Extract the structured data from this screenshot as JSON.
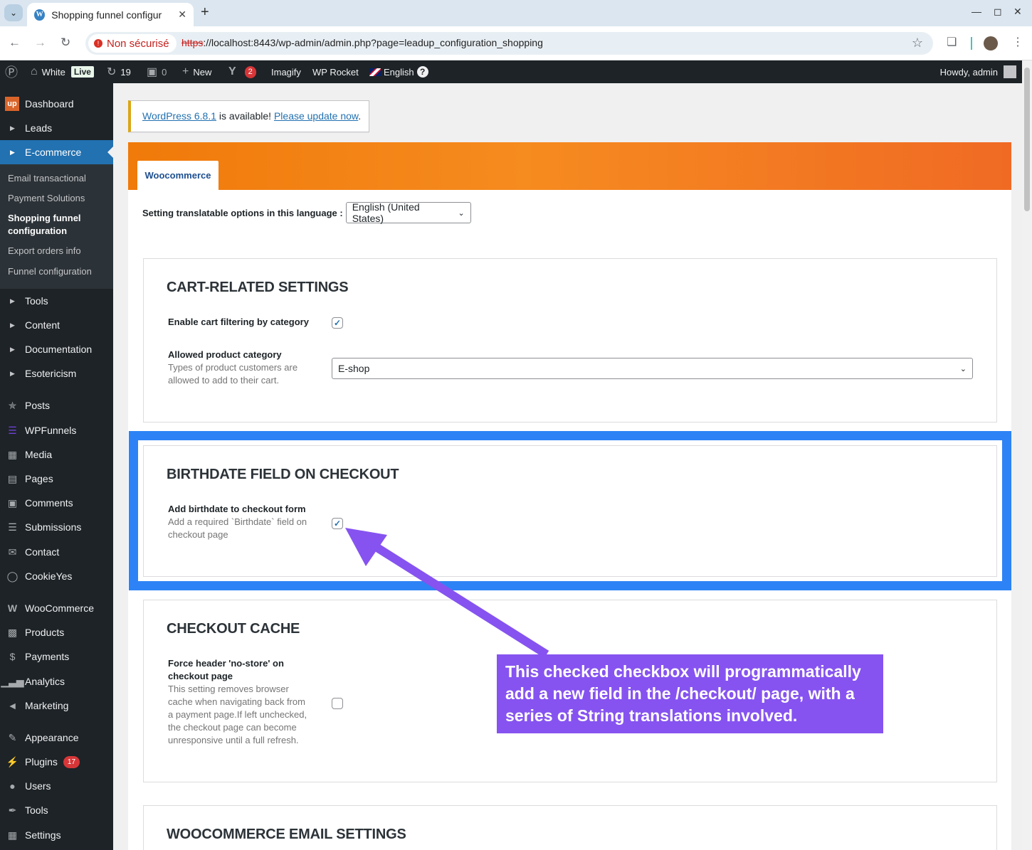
{
  "browser": {
    "tab_title": "Shopping funnel configur",
    "security_label": "Non sécurisé",
    "url_scheme": "https",
    "url_rest": "://localhost:8443/wp-admin/admin.php?page=leadup_configuration_shopping"
  },
  "adminbar": {
    "site_name": "White",
    "live_badge": "Live",
    "updates_count": "19",
    "comments_count": "0",
    "new_label": "New",
    "yoast_count": "2",
    "imagify": "Imagify",
    "wp_rocket": "WP Rocket",
    "language": "English",
    "howdy": "Howdy, admin"
  },
  "sidebar": {
    "items": [
      {
        "label": "Dashboard",
        "icon": "up-logo"
      },
      {
        "label": "Leads",
        "icon": "arrow-right-icon"
      },
      {
        "label": "E-commerce",
        "icon": "arrow-right-icon"
      },
      {
        "label": "Tools",
        "icon": "arrow-right-icon"
      },
      {
        "label": "Content",
        "icon": "arrow-right-icon"
      },
      {
        "label": "Documentation",
        "icon": "arrow-right-icon"
      },
      {
        "label": "Esotericism",
        "icon": "arrow-right-icon"
      },
      {
        "label": "Posts",
        "icon": "pin-icon"
      },
      {
        "label": "WPFunnels",
        "icon": "funnel-icon"
      },
      {
        "label": "Media",
        "icon": "media-icon"
      },
      {
        "label": "Pages",
        "icon": "pages-icon"
      },
      {
        "label": "Comments",
        "icon": "comment-icon"
      },
      {
        "label": "Submissions",
        "icon": "database-icon"
      },
      {
        "label": "Contact",
        "icon": "mail-icon"
      },
      {
        "label": "CookieYes",
        "icon": "cookie-icon"
      },
      {
        "label": "WooCommerce",
        "icon": "woo-icon"
      },
      {
        "label": "Products",
        "icon": "archive-icon"
      },
      {
        "label": "Payments",
        "icon": "payments-icon"
      },
      {
        "label": "Analytics",
        "icon": "chart-icon"
      },
      {
        "label": "Marketing",
        "icon": "megaphone-icon"
      },
      {
        "label": "Appearance",
        "icon": "brush-icon"
      },
      {
        "label": "Plugins",
        "icon": "plug-icon",
        "badge": "17"
      },
      {
        "label": "Users",
        "icon": "user-icon"
      },
      {
        "label": "Tools",
        "icon": "wrench-icon"
      },
      {
        "label": "Settings",
        "icon": "settings-icon"
      }
    ],
    "submenu": [
      "Email transactional",
      "Payment Solutions",
      "Shopping funnel configuration",
      "Export orders info",
      "Funnel configuration"
    ]
  },
  "notice": {
    "link1": "WordPress 6.8.1",
    "text": " is available! ",
    "link2": "Please update now",
    "end": "."
  },
  "panel": {
    "tab": "Woocommerce",
    "lang_label": "Setting translatable options in this language :",
    "lang_value": "English (United States)"
  },
  "sections": {
    "cart": {
      "title": "CART-RELATED SETTINGS",
      "filter_label": "Enable cart filtering by category",
      "filter_checked": true,
      "category_label": "Allowed product category",
      "category_desc": "Types of product customers are allowed to add to their cart.",
      "category_value": "E-shop"
    },
    "birthdate": {
      "title": "BIRTHDATE FIELD ON CHECKOUT",
      "label": "Add birthdate to checkout form",
      "desc": "Add a required `Birthdate` field on checkout page",
      "checked": true
    },
    "cache": {
      "title": "CHECKOUT CACHE",
      "label": "Force header 'no-store' on checkout page",
      "desc": "This setting removes browser cache when navigating back from a payment page.If left unchecked, the checkout page can become unresponsive until a full refresh.",
      "checked": false
    },
    "email": {
      "title": "WOOCOMMERCE EMAIL SETTINGS"
    }
  },
  "annotation": {
    "text": "This checked checkbox will programmatically add a new field in the /checkout/ page, with a series of String translations involved.",
    "highlight_color": "#2d83f5",
    "callout_color": "#8653f0"
  }
}
